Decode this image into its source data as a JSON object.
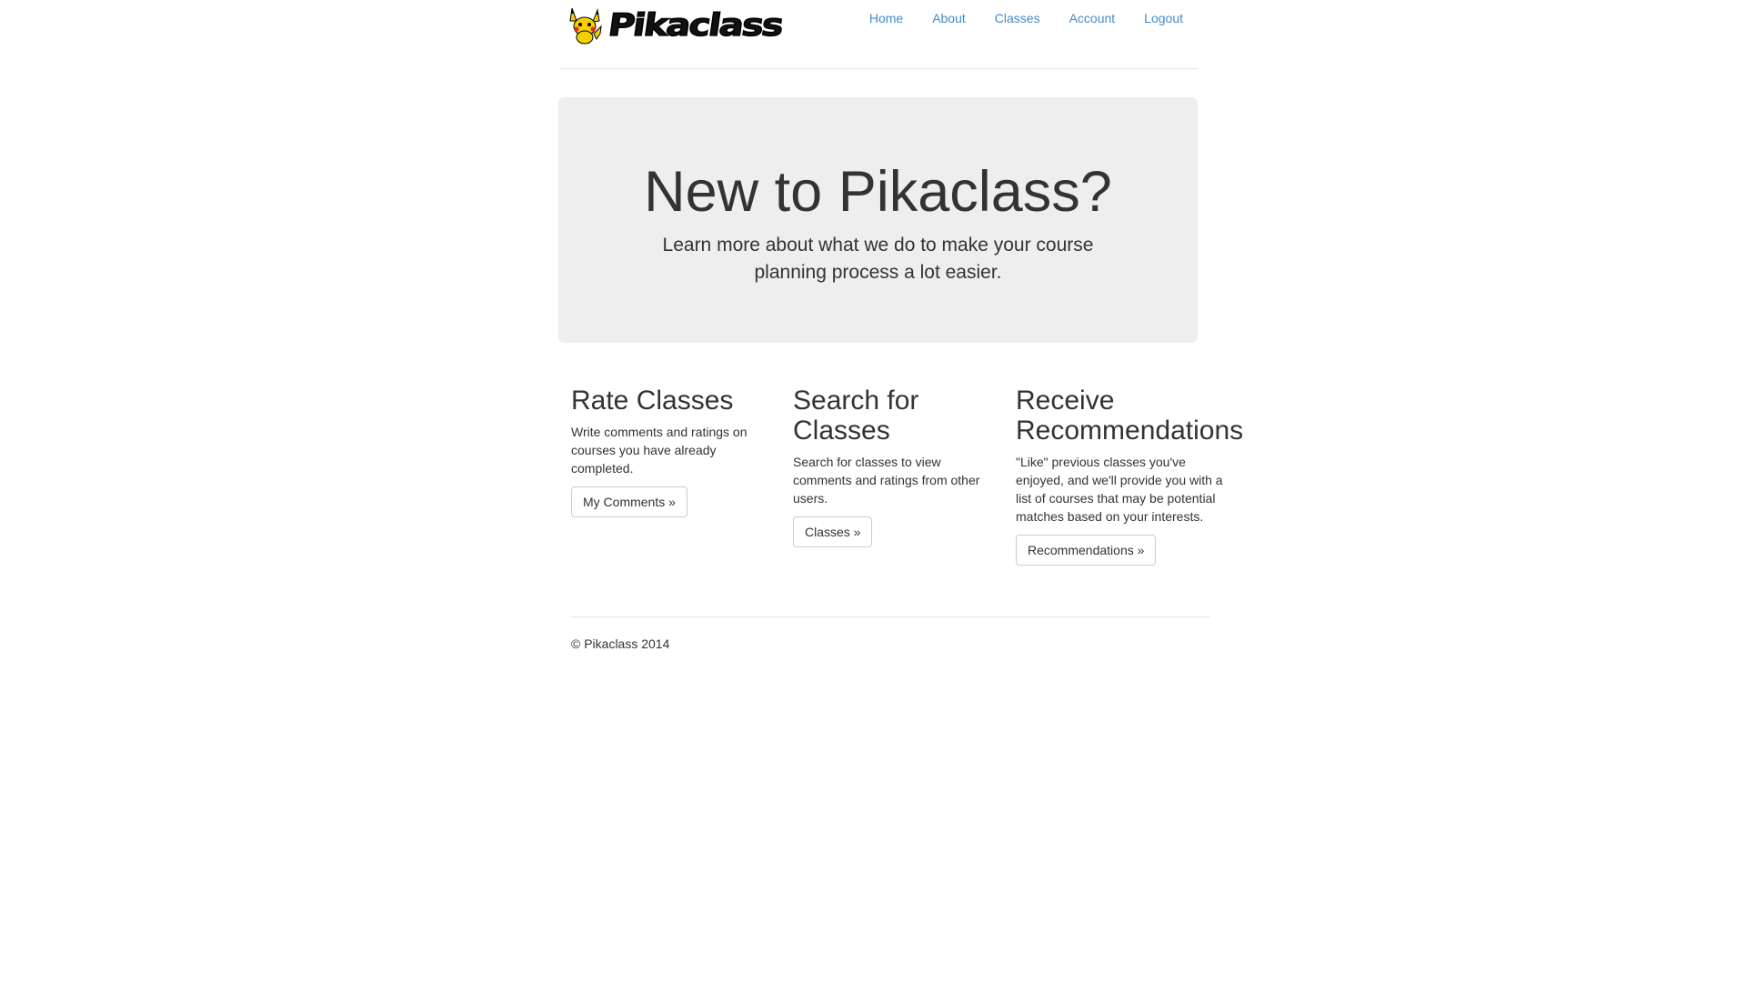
{
  "brand": {
    "name": "Pikaclass"
  },
  "nav": {
    "items": [
      {
        "label": "Home"
      },
      {
        "label": "About"
      },
      {
        "label": "Classes"
      },
      {
        "label": "Account"
      },
      {
        "label": "Logout"
      }
    ]
  },
  "jumbotron": {
    "title": "New to Pikaclass?",
    "text": "Learn more about what we do to make your course planning process a lot easier."
  },
  "features": [
    {
      "title": "Rate Classes",
      "text": "Write comments and ratings on courses you have already completed.",
      "button": "My Comments »"
    },
    {
      "title_line1": "Search for",
      "title_line2": "Classes",
      "text": "Search for classes to view comments and ratings from other users.",
      "button": "Classes »"
    },
    {
      "title_line1": "Receive",
      "title_line2": "Recommendations",
      "text": "\"Like\" previous classes you've enjoyed, and we'll provide you with a list of courses that may be potential matches based on your interests.",
      "button": "Recommendations »"
    }
  ],
  "footer": {
    "copyright": "© Pikaclass 2014"
  },
  "colors": {
    "link": "#428bca",
    "jumbotron_bg": "#eeeeee",
    "text": "#333333"
  },
  "icons": {
    "logo": "pikachu-logo-icon"
  }
}
